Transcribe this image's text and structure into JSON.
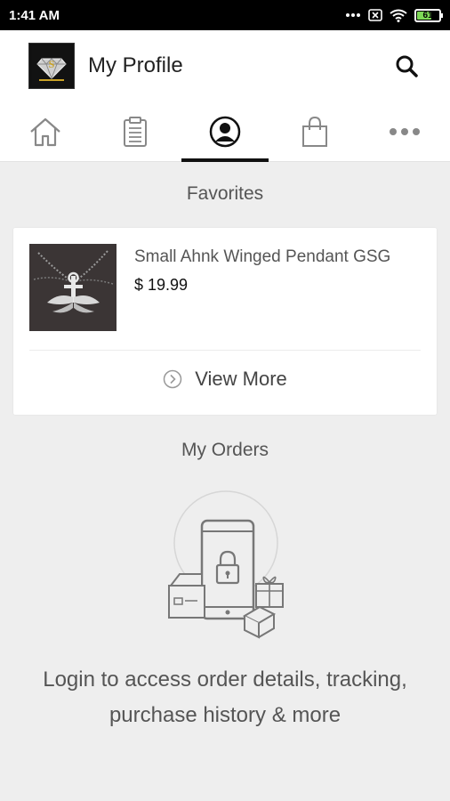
{
  "status_bar": {
    "time": "1:41 AM",
    "battery_level": "61",
    "battery_fraction": 0.61
  },
  "header": {
    "title": "My Profile"
  },
  "tabs": [
    {
      "icon": "home-icon"
    },
    {
      "icon": "clipboard-icon"
    },
    {
      "icon": "profile-icon",
      "active": true
    },
    {
      "icon": "shopping-bag-icon"
    },
    {
      "icon": "more-icon"
    }
  ],
  "favorites": {
    "heading": "Favorites",
    "items": [
      {
        "name": "Small Ahnk Winged Pendant GSG",
        "price": "$ 19.99"
      }
    ],
    "view_more_label": "View More"
  },
  "orders": {
    "heading": "My Orders",
    "login_message_line1": "Login to access order details, tracking,",
    "login_message_line2": "purchase history & more"
  },
  "colors": {
    "accent": "#111111",
    "background": "#eeeeee",
    "battery": "#7ed957"
  }
}
